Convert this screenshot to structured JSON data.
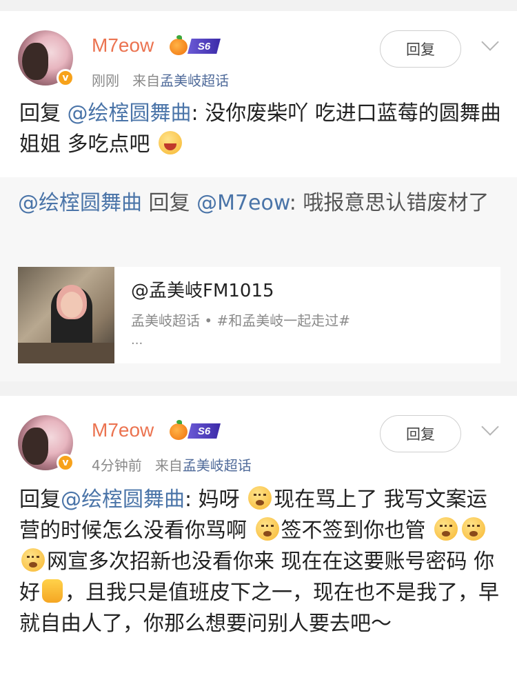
{
  "posts": [
    {
      "username": "M7eow",
      "level_badge": "S6",
      "time": "刚刚",
      "source_prefix": "来自",
      "source": "孟美岐超话",
      "reply_button": "回复",
      "body": {
        "prefix": "回复",
        "mention": "@绘榁圆舞曲",
        "text_before_emoji": ": 没你废柴吖 吃进口蓝莓的圆舞曲姐姐 多吃点吧"
      },
      "quote": {
        "author": "@绘榁圆舞曲",
        "reply_word": " 回复 ",
        "target": "@M7eow",
        "text": ": 哦报意思认错废材了"
      },
      "link_card": {
        "title": "@孟美岐FM1015",
        "subtitle": "孟美岐超话 • #和孟美岐一起走过#",
        "more": "..."
      }
    },
    {
      "username": "M7eow",
      "level_badge": "S6",
      "time": "4分钟前",
      "source_prefix": "来自",
      "source": "孟美岐超话",
      "reply_button": "回复",
      "body": {
        "prefix": "回复",
        "mention": "@绘榁圆舞曲",
        "seg1": ": 妈呀",
        "seg2": "现在骂上了 我写文案运营的时候怎么没看你骂啊",
        "seg3": "签不签到你也管",
        "seg4": "网宣多次招新也没看你来 现在在这要账号密码 你好",
        "seg5": "，且我只是值班皮下之一，现在也不是我了，早就自由人了，你那么想要问别人要去吧～"
      }
    }
  ]
}
